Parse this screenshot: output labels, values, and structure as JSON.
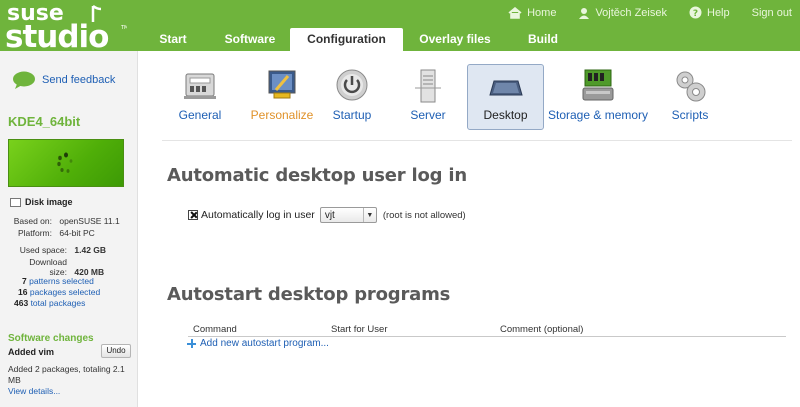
{
  "logo": {
    "line1": "suse",
    "line2": "studio",
    "tm": "TM"
  },
  "toplinks": [
    {
      "label": "Home",
      "icon": "home-icon"
    },
    {
      "label": "Vojtěch Zeisek",
      "icon": "user-icon"
    },
    {
      "label": "Help",
      "icon": "help-icon"
    },
    {
      "label": "Sign out",
      "icon": ""
    }
  ],
  "tabs": [
    {
      "label": "Start",
      "active": false
    },
    {
      "label": "Software",
      "active": false
    },
    {
      "label": "Configuration",
      "active": true
    },
    {
      "label": "Overlay files",
      "active": false
    },
    {
      "label": "Build",
      "active": false
    }
  ],
  "sidebar": {
    "feedback": "Send feedback",
    "appliance_name": "KDE4_64bit",
    "disk_image": "Disk image",
    "based_on_label": "Based on:",
    "based_on": "openSUSE 11.1",
    "platform_label": "Platform:",
    "platform": "64-bit PC",
    "used_space_label": "Used space:",
    "used_space": "1.42 GB",
    "download_size_label": "Download size:",
    "download_size": "420 MB",
    "patterns_count": "7",
    "patterns_label": "patterns selected",
    "packages_count": "16",
    "packages_label": "packages selected",
    "total_count": "463",
    "total_label": "total packages",
    "software_changes": "Software changes",
    "added_vim": "Added vim",
    "undo": "Undo",
    "added_text": "Added 2 packages, totaling 2.1 MB",
    "view_details": "View details..."
  },
  "categories": [
    {
      "label": "General",
      "icon": "general-icon"
    },
    {
      "label": "Personalize",
      "icon": "personalize-icon"
    },
    {
      "label": "Startup",
      "icon": "startup-icon"
    },
    {
      "label": "Server",
      "icon": "server-icon"
    },
    {
      "label": "Desktop",
      "icon": "desktop-icon",
      "active": true
    },
    {
      "label": "Storage & memory",
      "icon": "storage-memory-icon"
    },
    {
      "label": "Scripts",
      "icon": "scripts-icon"
    }
  ],
  "main": {
    "autologin_title": "Automatic desktop user log in",
    "autologin_label": "Automatically log in user",
    "autologin_checked": true,
    "autologin_user": "vjt",
    "autologin_note": "(root is not allowed)",
    "autostart_title": "Autostart desktop programs",
    "columns": [
      "Command",
      "Start for User",
      "Comment (optional)"
    ],
    "add_new": "Add new autostart program..."
  },
  "colors": {
    "brand_green": "#6fb43c",
    "link_blue": "#1e5fb4",
    "personalize_orange": "#e0922a",
    "active_tab_bg": "#dfe7f2"
  }
}
